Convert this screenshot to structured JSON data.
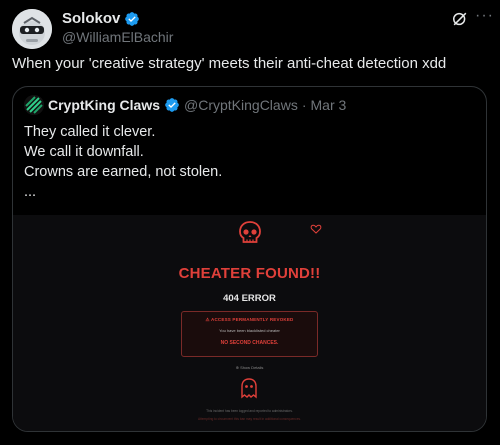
{
  "post": {
    "author": {
      "display_name": "Solokov",
      "handle": "@WilliamElBachir",
      "verified": true,
      "avatar_icon": "masked-robot-avatar"
    },
    "text": "When your 'creative strategy' meets their anti-cheat detection xdd",
    "icons": {
      "grok": "grok-icon",
      "more": "more-options-icon"
    },
    "more_label": "···"
  },
  "quoted_post": {
    "author": {
      "display_name": "CryptKing Claws",
      "handle": "@CryptKingClaws",
      "verified": true,
      "avatar_icon": "green-striped-shield-avatar"
    },
    "separator": "·",
    "date": "Mar 3",
    "body_lines": [
      "They called it clever.",
      "We call it downfall.",
      "",
      "Crowns are earned, not stolen.",
      "..."
    ],
    "image": {
      "title": "CHEATER FOUND!!",
      "error_code": "404 ERROR",
      "alert": {
        "title": "ACCESS PERMANENTLY REVOKED",
        "message": "You have been blacklisted cheater",
        "cta": "NO SECOND CHANCES."
      },
      "show_details": "Show Details",
      "footer_lines": [
        "This incident has been logged and reported to administrators.",
        "Attempting to circumvent this ban may result in additional consequences."
      ],
      "colors": {
        "accent": "#e0403a",
        "background": "#0c0c0e"
      },
      "icons": [
        "skull-icon",
        "heart-icon",
        "ghost-icon",
        "warning-icon"
      ]
    }
  },
  "colors": {
    "verified_blue": "#1d9bf0",
    "secondary_text": "#71767b",
    "border": "#2f3336"
  }
}
